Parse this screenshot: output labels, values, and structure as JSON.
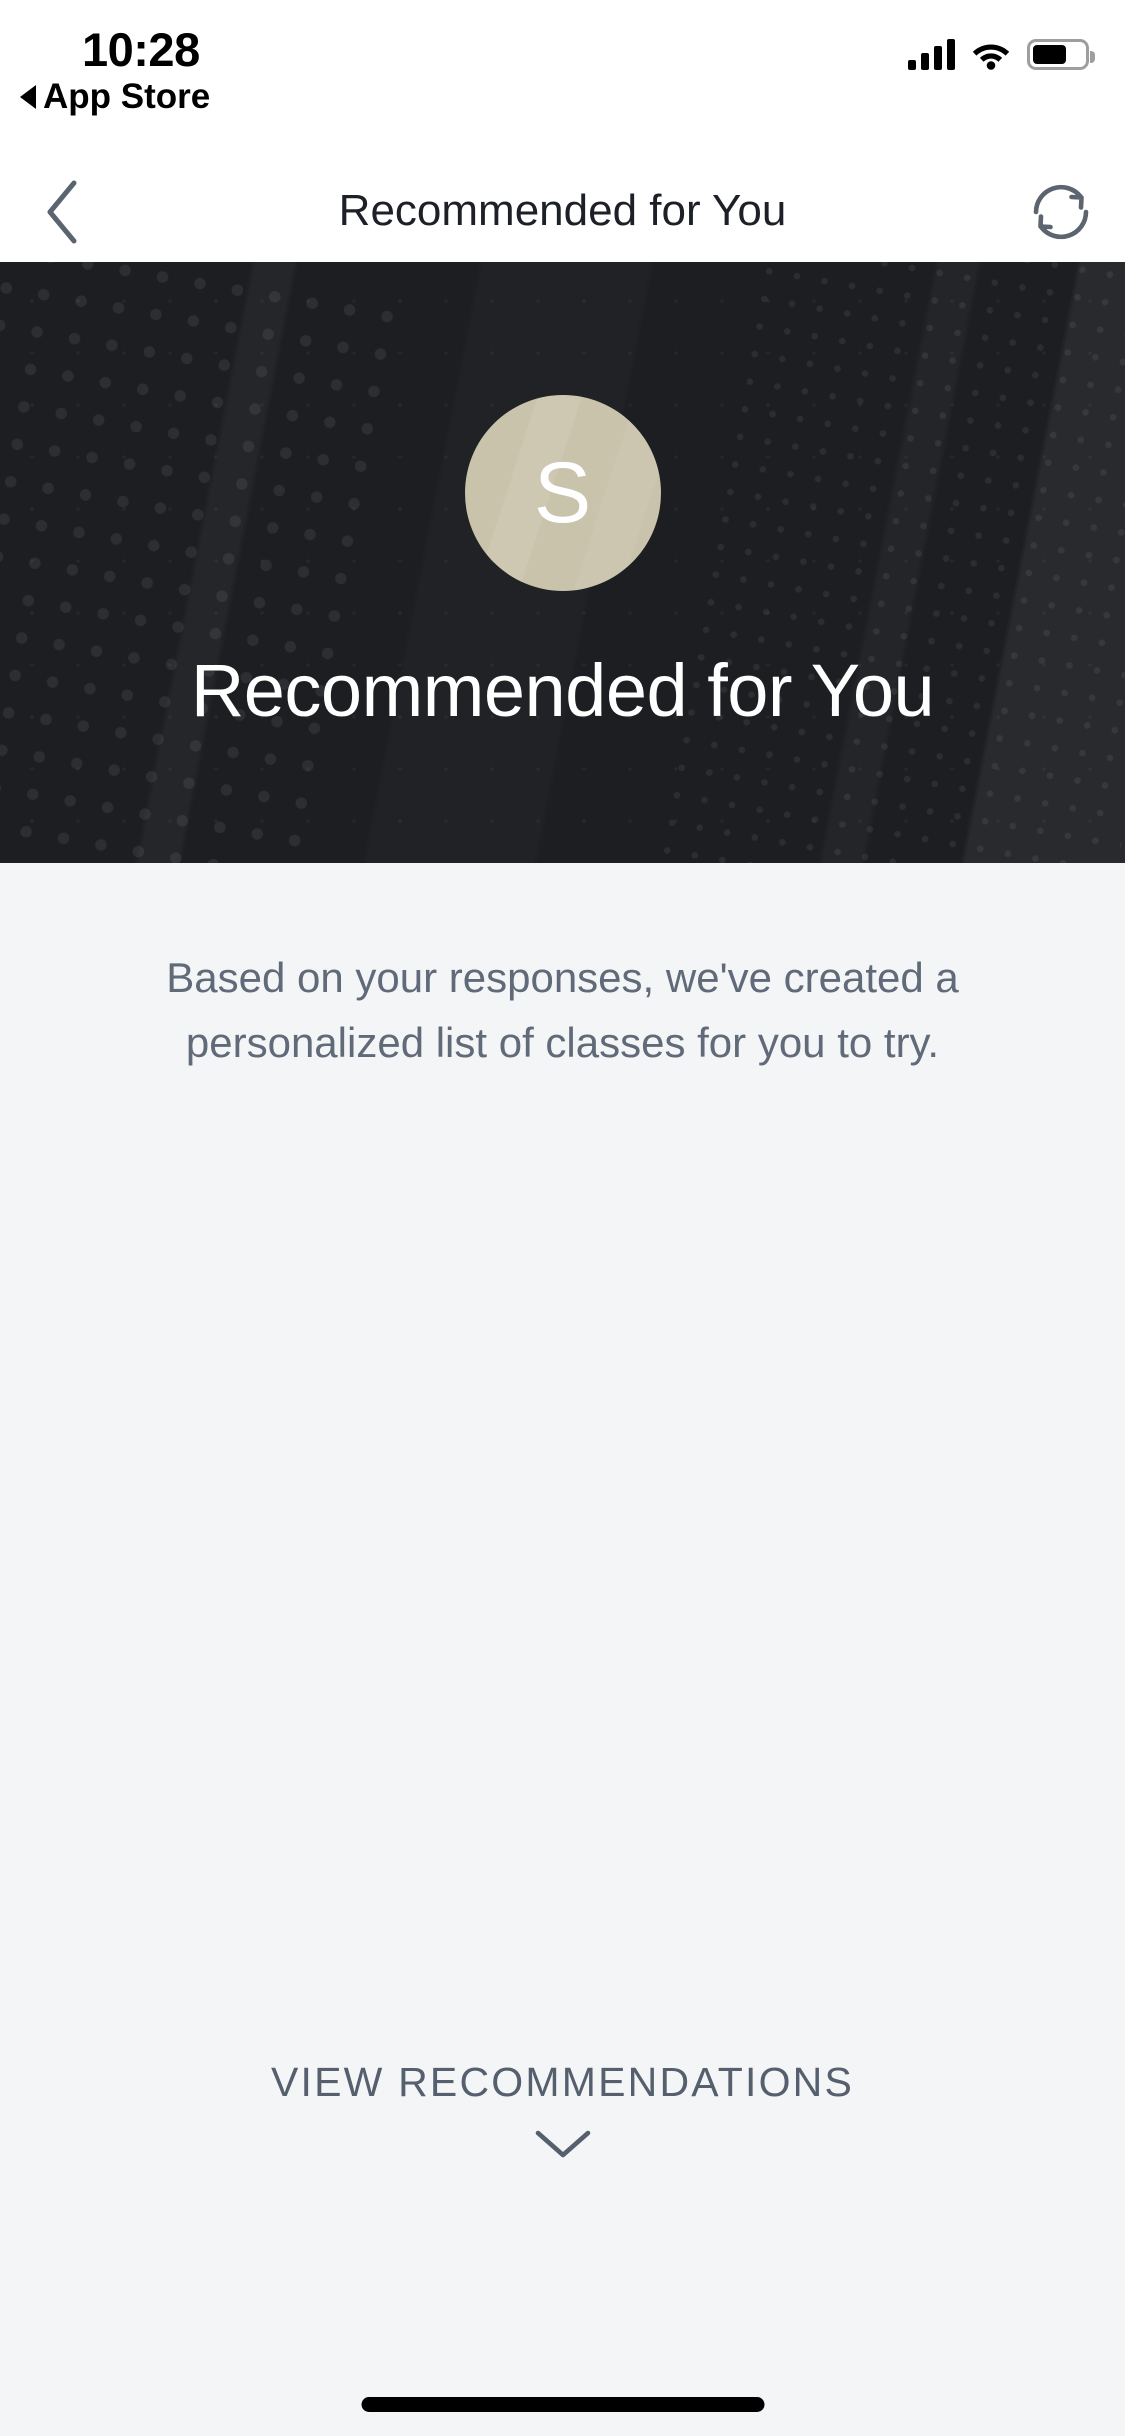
{
  "status_bar": {
    "time": "10:28",
    "back_app_label": "App Store",
    "back_app_icon": "triangle-left-icon",
    "cellular_icon": "cellular-bars-icon",
    "wifi_icon": "wifi-icon",
    "battery_icon": "battery-icon",
    "battery_level_percent": 66
  },
  "nav_bar": {
    "back_icon": "chevron-left-icon",
    "title": "Recommended for You",
    "refresh_icon": "refresh-icon"
  },
  "hero": {
    "avatar_initial": "S",
    "avatar_color": "#c9c3ac",
    "title": "Recommended for You",
    "background_color": "#1c1e21"
  },
  "body": {
    "subtitle": "Based on your responses, we've created a personalized list of classes for you to try."
  },
  "cta": {
    "label": "VIEW RECOMMENDATIONS",
    "chevron_icon": "chevron-down-icon"
  },
  "home_indicator": {
    "name": "home-indicator"
  },
  "colors": {
    "page_background": "#f4f5f7",
    "nav_background": "#ffffff",
    "text_primary": "#1d2026",
    "text_muted": "#606a78",
    "icon_slate": "#5c6470",
    "accent_tan": "#c9c3ac"
  }
}
